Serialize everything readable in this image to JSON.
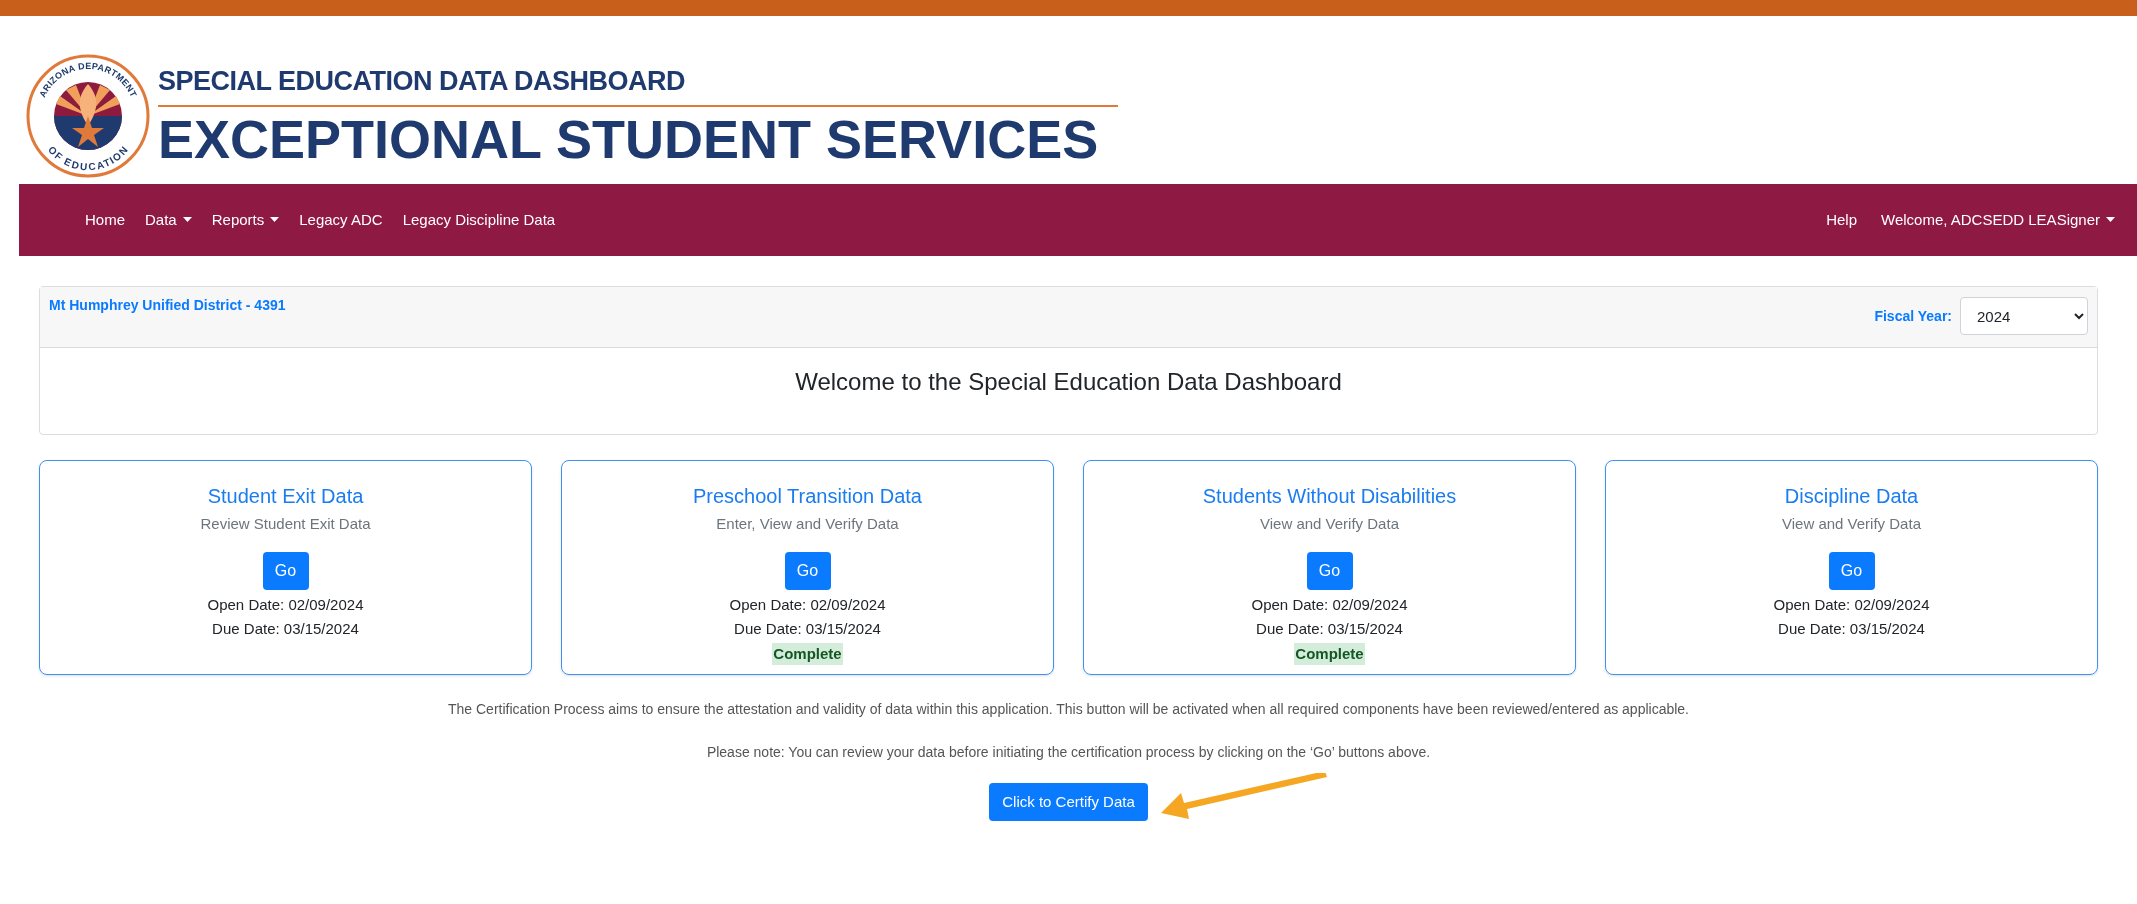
{
  "logo": {
    "top_text": "ARIZONA DEPARTMENT",
    "bottom_text": "OF EDUCATION"
  },
  "header": {
    "subtitle": "SPECIAL EDUCATION DATA DASHBOARD",
    "title": "EXCEPTIONAL STUDENT SERVICES"
  },
  "nav": {
    "left": [
      {
        "label": "Home",
        "dropdown": false
      },
      {
        "label": "Data",
        "dropdown": true
      },
      {
        "label": "Reports",
        "dropdown": true
      },
      {
        "label": "Legacy ADC",
        "dropdown": false
      },
      {
        "label": "Legacy Discipline Data",
        "dropdown": false
      }
    ],
    "right": [
      {
        "label": "Help",
        "dropdown": false
      },
      {
        "label": "Welcome, ADCSEDD LEASigner",
        "dropdown": true
      }
    ]
  },
  "district": "Mt Humphrey Unified District - 4391",
  "fiscal_year": {
    "label": "Fiscal Year:",
    "value": "2024"
  },
  "welcome": "Welcome to the Special Education Data Dashboard",
  "cards": [
    {
      "title": "Student Exit Data",
      "subtitle": "Review Student Exit Data",
      "button": "Go",
      "open_date": "Open Date: 02/09/2024",
      "due_date": "Due Date: 03/15/2024"
    },
    {
      "title": "Preschool Transition Data",
      "subtitle": "Enter, View and Verify Data",
      "button": "Go",
      "open_date": "Open Date: 02/09/2024",
      "due_date": "Due Date: 03/15/2024",
      "status": "Complete"
    },
    {
      "title": "Students Without Disabilities",
      "subtitle": "View and Verify Data",
      "button": "Go",
      "open_date": "Open Date: 02/09/2024",
      "due_date": "Due Date: 03/15/2024",
      "status": "Complete"
    },
    {
      "title": "Discipline Data",
      "subtitle": "View and Verify Data",
      "button": "Go",
      "open_date": "Open Date: 02/09/2024",
      "due_date": "Due Date: 03/15/2024"
    }
  ],
  "notes": [
    "The Certification Process aims to ensure the attestation and validity of data within this application. This button will be activated when all required components have been reviewed/entered as applicable.",
    "Please note: You can review your data before initiating the certification process by clicking on the ‘Go’ buttons above."
  ],
  "certify_button": "Click to Certify Data"
}
